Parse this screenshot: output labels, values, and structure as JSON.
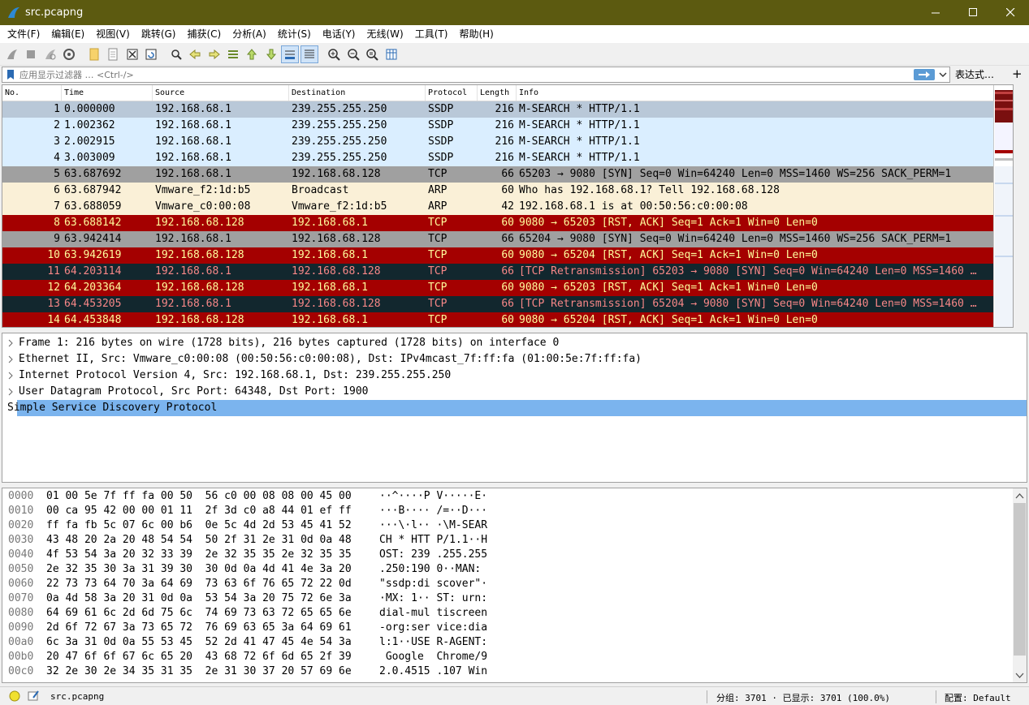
{
  "window": {
    "title": "src.pcapng"
  },
  "menu": [
    "文件(F)",
    "编辑(E)",
    "视图(V)",
    "跳转(G)",
    "捕获(C)",
    "分析(A)",
    "统计(S)",
    "电话(Y)",
    "无线(W)",
    "工具(T)",
    "帮助(H)"
  ],
  "toolbar": {
    "icons": [
      "shark-fin-start-icon",
      "stop-icon",
      "restart-icon",
      "options-gear-icon",
      "sep",
      "open-file-icon",
      "file-grid-icon",
      "close-file-icon",
      "reload-icon",
      "sep",
      "find-icon",
      "go-back-icon",
      "go-forward-icon",
      "go-to-packet-icon",
      "go-first-icon",
      "go-last-icon",
      "autoscroll-icon",
      "colorize-icon",
      "sep",
      "zoom-in-icon",
      "zoom-out-icon",
      "zoom-reset-icon",
      "resize-columns-icon"
    ]
  },
  "filter": {
    "placeholder": "应用显示过滤器 … <Ctrl-/>",
    "expression_label": "表达式…",
    "add_label": "+"
  },
  "packet_list": {
    "columns": [
      "No.",
      "Time",
      "Source",
      "Destination",
      "Protocol",
      "Length",
      "Info"
    ],
    "rows": [
      {
        "no": "1",
        "time": "0.000000",
        "src": "192.168.68.1",
        "dst": "239.255.255.250",
        "proto": "SSDP",
        "len": "216",
        "info": "M-SEARCH * HTTP/1.1",
        "bg": "#b9c8d8",
        "fg": "#000000"
      },
      {
        "no": "2",
        "time": "1.002362",
        "src": "192.168.68.1",
        "dst": "239.255.255.250",
        "proto": "SSDP",
        "len": "216",
        "info": "M-SEARCH * HTTP/1.1",
        "bg": "#daeeff",
        "fg": "#000000"
      },
      {
        "no": "3",
        "time": "2.002915",
        "src": "192.168.68.1",
        "dst": "239.255.255.250",
        "proto": "SSDP",
        "len": "216",
        "info": "M-SEARCH * HTTP/1.1",
        "bg": "#daeeff",
        "fg": "#000000"
      },
      {
        "no": "4",
        "time": "3.003009",
        "src": "192.168.68.1",
        "dst": "239.255.255.250",
        "proto": "SSDP",
        "len": "216",
        "info": "M-SEARCH * HTTP/1.1",
        "bg": "#daeeff",
        "fg": "#000000"
      },
      {
        "no": "5",
        "time": "63.687692",
        "src": "192.168.68.1",
        "dst": "192.168.68.128",
        "proto": "TCP",
        "len": "66",
        "info": "65203 → 9080 [SYN] Seq=0 Win=64240 Len=0 MSS=1460 WS=256 SACK_PERM=1",
        "bg": "#a0a0a0",
        "fg": "#000000"
      },
      {
        "no": "6",
        "time": "63.687942",
        "src": "Vmware_f2:1d:b5",
        "dst": "Broadcast",
        "proto": "ARP",
        "len": "60",
        "info": "Who has 192.168.68.1? Tell 192.168.68.128",
        "bg": "#faf0d7",
        "fg": "#000000"
      },
      {
        "no": "7",
        "time": "63.688059",
        "src": "Vmware_c0:00:08",
        "dst": "Vmware_f2:1d:b5",
        "proto": "ARP",
        "len": "42",
        "info": "192.168.68.1 is at 00:50:56:c0:00:08",
        "bg": "#faf0d7",
        "fg": "#000000"
      },
      {
        "no": "8",
        "time": "63.688142",
        "src": "192.168.68.128",
        "dst": "192.168.68.1",
        "proto": "TCP",
        "len": "60",
        "info": "9080 → 65203 [RST, ACK] Seq=1 Ack=1 Win=0 Len=0",
        "bg": "#a40000",
        "fg": "#fffc9c"
      },
      {
        "no": "9",
        "time": "63.942414",
        "src": "192.168.68.1",
        "dst": "192.168.68.128",
        "proto": "TCP",
        "len": "66",
        "info": "65204 → 9080 [SYN] Seq=0 Win=64240 Len=0 MSS=1460 WS=256 SACK_PERM=1",
        "bg": "#a0a0a0",
        "fg": "#000000"
      },
      {
        "no": "10",
        "time": "63.942619",
        "src": "192.168.68.128",
        "dst": "192.168.68.1",
        "proto": "TCP",
        "len": "60",
        "info": "9080 → 65204 [RST, ACK] Seq=1 Ack=1 Win=0 Len=0",
        "bg": "#a40000",
        "fg": "#fffc9c"
      },
      {
        "no": "11",
        "time": "64.203114",
        "src": "192.168.68.1",
        "dst": "192.168.68.128",
        "proto": "TCP",
        "len": "66",
        "info": "[TCP Retransmission] 65203 → 9080 [SYN] Seq=0 Win=64240 Len=0 MSS=1460 …",
        "bg": "#12272e",
        "fg": "#f78787"
      },
      {
        "no": "12",
        "time": "64.203364",
        "src": "192.168.68.128",
        "dst": "192.168.68.1",
        "proto": "TCP",
        "len": "60",
        "info": "9080 → 65203 [RST, ACK] Seq=1 Ack=1 Win=0 Len=0",
        "bg": "#a40000",
        "fg": "#fffc9c"
      },
      {
        "no": "13",
        "time": "64.453205",
        "src": "192.168.68.1",
        "dst": "192.168.68.128",
        "proto": "TCP",
        "len": "66",
        "info": "[TCP Retransmission] 65204 → 9080 [SYN] Seq=0 Win=64240 Len=0 MSS=1460 …",
        "bg": "#12272e",
        "fg": "#f78787"
      },
      {
        "no": "14",
        "time": "64.453848",
        "src": "192.168.68.128",
        "dst": "192.168.68.1",
        "proto": "TCP",
        "len": "60",
        "info": "9080 → 65204 [RST, ACK] Seq=1 Ack=1 Win=0 Len=0",
        "bg": "#a40000",
        "fg": "#fffc9c"
      }
    ]
  },
  "details": [
    {
      "text": "Frame 1: 216 bytes on wire (1728 bits), 216 bytes captured (1728 bits) on interface 0",
      "selected": false
    },
    {
      "text": "Ethernet II, Src: Vmware_c0:00:08 (00:50:56:c0:00:08), Dst: IPv4mcast_7f:ff:fa (01:00:5e:7f:ff:fa)",
      "selected": false
    },
    {
      "text": "Internet Protocol Version 4, Src: 192.168.68.1, Dst: 239.255.255.250",
      "selected": false
    },
    {
      "text": "User Datagram Protocol, Src Port: 64348, Dst Port: 1900",
      "selected": false
    },
    {
      "text": "Simple Service Discovery Protocol",
      "selected": true
    }
  ],
  "bytes": [
    {
      "off": "0000",
      "hex": "01 00 5e 7f ff fa 00 50  56 c0 00 08 08 00 45 00",
      "ascii": "··^····P V·····E·"
    },
    {
      "off": "0010",
      "hex": "00 ca 95 42 00 00 01 11  2f 3d c0 a8 44 01 ef ff",
      "ascii": "···B···· /=··D···"
    },
    {
      "off": "0020",
      "hex": "ff fa fb 5c 07 6c 00 b6  0e 5c 4d 2d 53 45 41 52",
      "ascii": "···\\·l·· ·\\M-SEAR"
    },
    {
      "off": "0030",
      "hex": "43 48 20 2a 20 48 54 54  50 2f 31 2e 31 0d 0a 48",
      "ascii": "CH * HTT P/1.1··H"
    },
    {
      "off": "0040",
      "hex": "4f 53 54 3a 20 32 33 39  2e 32 35 35 2e 32 35 35",
      "ascii": "OST: 239 .255.255"
    },
    {
      "off": "0050",
      "hex": "2e 32 35 30 3a 31 39 30  30 0d 0a 4d 41 4e 3a 20",
      "ascii": ".250:190 0··MAN: "
    },
    {
      "off": "0060",
      "hex": "22 73 73 64 70 3a 64 69  73 63 6f 76 65 72 22 0d",
      "ascii": "\"ssdp:di scover\"·"
    },
    {
      "off": "0070",
      "hex": "0a 4d 58 3a 20 31 0d 0a  53 54 3a 20 75 72 6e 3a",
      "ascii": "·MX: 1·· ST: urn:"
    },
    {
      "off": "0080",
      "hex": "64 69 61 6c 2d 6d 75 6c  74 69 73 63 72 65 65 6e",
      "ascii": "dial-mul tiscreen"
    },
    {
      "off": "0090",
      "hex": "2d 6f 72 67 3a 73 65 72  76 69 63 65 3a 64 69 61",
      "ascii": "-org:ser vice:dia"
    },
    {
      "off": "00a0",
      "hex": "6c 3a 31 0d 0a 55 53 45  52 2d 41 47 45 4e 54 3a",
      "ascii": "l:1··USE R-AGENT:"
    },
    {
      "off": "00b0",
      "hex": "20 47 6f 6f 67 6c 65 20  43 68 72 6f 6d 65 2f 39",
      "ascii": " Google  Chrome/9"
    },
    {
      "off": "00c0",
      "hex": "32 2e 30 2e 34 35 31 35  2e 31 30 37 20 57 69 6e",
      "ascii": "2.0.4515 .107 Win"
    }
  ],
  "status": {
    "file": "src.pcapng",
    "packets": "分组: 3701 · 已显示: 3701 (100.0%)",
    "profile": "配置: Default"
  }
}
